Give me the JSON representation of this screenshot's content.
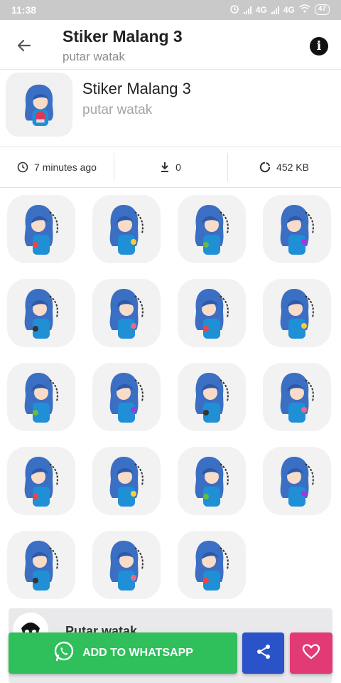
{
  "status_bar": {
    "time": "11:38",
    "network_1": "4G",
    "network_2": "4G",
    "battery": "47"
  },
  "app_bar": {
    "title": "Stiker Malang 3",
    "subtitle": "putar watak",
    "back_icon": "arrow-left-icon",
    "info_icon": "info-icon"
  },
  "pack": {
    "name": "Stiker Malang 3",
    "publisher": "putar watak"
  },
  "info_row": {
    "updated": "7 minutes ago",
    "downloads": "0",
    "size": "452 KB"
  },
  "stickers": [
    {
      "label": "sticker 1"
    },
    {
      "label": "sticker 2"
    },
    {
      "label": "sticker 3"
    },
    {
      "label": "sticker 4"
    },
    {
      "label": "sticker 5"
    },
    {
      "label": "sticker 6"
    },
    {
      "label": "sticker 7"
    },
    {
      "label": "sticker 8"
    },
    {
      "label": "sticker 9"
    },
    {
      "label": "sticker 10"
    },
    {
      "label": "sticker 11"
    },
    {
      "label": "sticker 12"
    },
    {
      "label": "sticker 13"
    },
    {
      "label": "sticker 14"
    },
    {
      "label": "sticker 15"
    },
    {
      "label": "sticker 16"
    },
    {
      "label": "sticker 17"
    },
    {
      "label": "sticker 18"
    },
    {
      "label": "sticker 19"
    }
  ],
  "publisher_card": {
    "name": "Putar watak"
  },
  "actions": {
    "add_to_whatsapp": "ADD TO WHATSAPP",
    "share_icon": "share-icon",
    "favorite_icon": "heart-icon"
  },
  "colors": {
    "whatsapp_green": "#2fbf5b",
    "share_blue": "#2a53c9",
    "favorite_pink": "#e23a74",
    "hair_blue": "#3b6fc4",
    "shirt_blue": "#1f8fd6"
  }
}
